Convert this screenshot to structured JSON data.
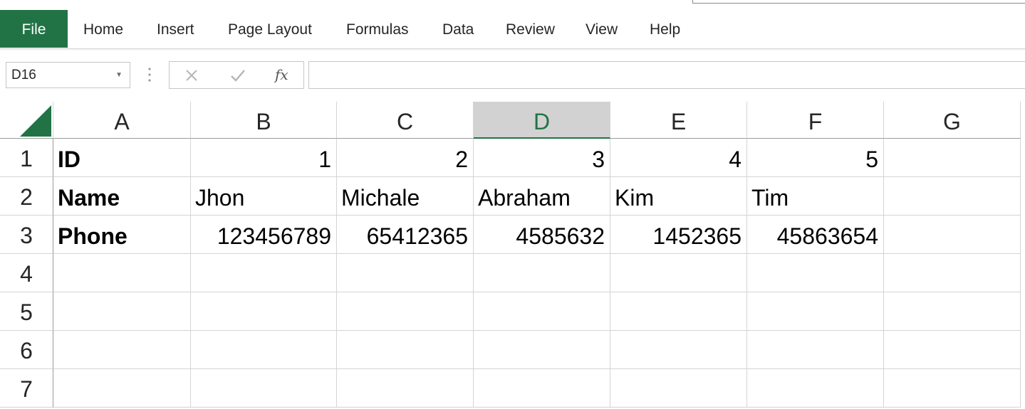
{
  "ribbon": {
    "tabs": [
      "File",
      "Home",
      "Insert",
      "Page Layout",
      "Formulas",
      "Data",
      "Review",
      "View",
      "Help"
    ],
    "active_tab": "File",
    "accent_color": "#217346"
  },
  "formula_bar": {
    "name_box": "D16",
    "fx_label": "fx",
    "formula": ""
  },
  "sheet": {
    "selected_cell": "D16",
    "columns": [
      "A",
      "B",
      "C",
      "D",
      "E",
      "F",
      "G"
    ],
    "rows": [
      "1",
      "2",
      "3",
      "4",
      "5",
      "6",
      "7"
    ],
    "cells": {
      "A1": "ID",
      "B1": "1",
      "C1": "2",
      "D1": "3",
      "E1": "4",
      "F1": "5",
      "A2": "Name",
      "B2": "Jhon",
      "C2": "Michale",
      "D2": "Abraham",
      "E2": "Kim",
      "F2": "Tim",
      "A3": "Phone",
      "B3": "123456789",
      "C3": "65412365",
      "D3": "4585632",
      "E3": "1452365",
      "F3": "45863654"
    }
  }
}
